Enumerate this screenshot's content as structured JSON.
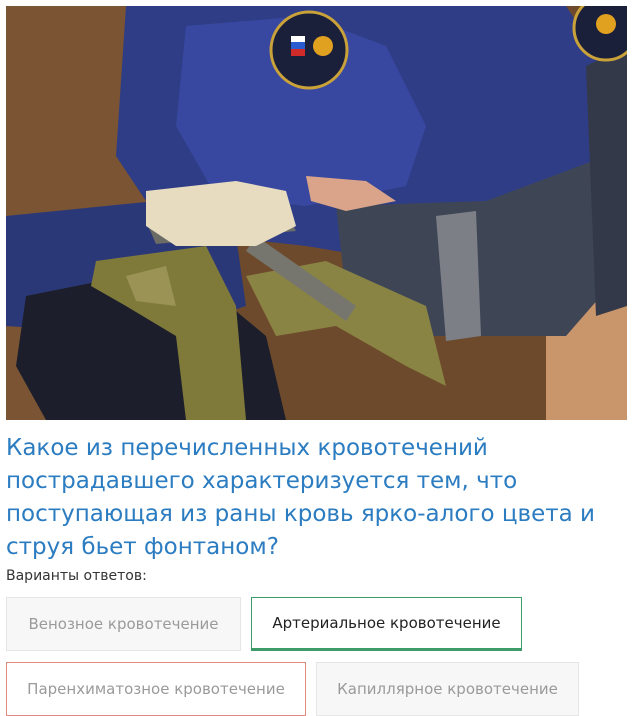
{
  "photo": {
    "alt": "Наложение жгута",
    "patch_text": "МЧС РОССИИ EMERCOM"
  },
  "question": {
    "text": "Какое из перечисленных кровотечений пострадавшего характеризуется тем, что поступающая из раны кровь ярко-алого цвета и струя бьет фонтаном?"
  },
  "answers_label": "Варианты ответов:",
  "answers": [
    {
      "label": "Венозное кровотечение",
      "state": "default"
    },
    {
      "label": "Артериальное кровотечение",
      "state": "correct"
    },
    {
      "label": "Паренхиматозное кровотечение",
      "state": "wrong"
    },
    {
      "label": "Капиллярное кровотечение",
      "state": "default"
    }
  ],
  "colors": {
    "question": "#2b7cc0",
    "correct_border": "#3e9b6a",
    "wrong_border": "#e08a80"
  }
}
